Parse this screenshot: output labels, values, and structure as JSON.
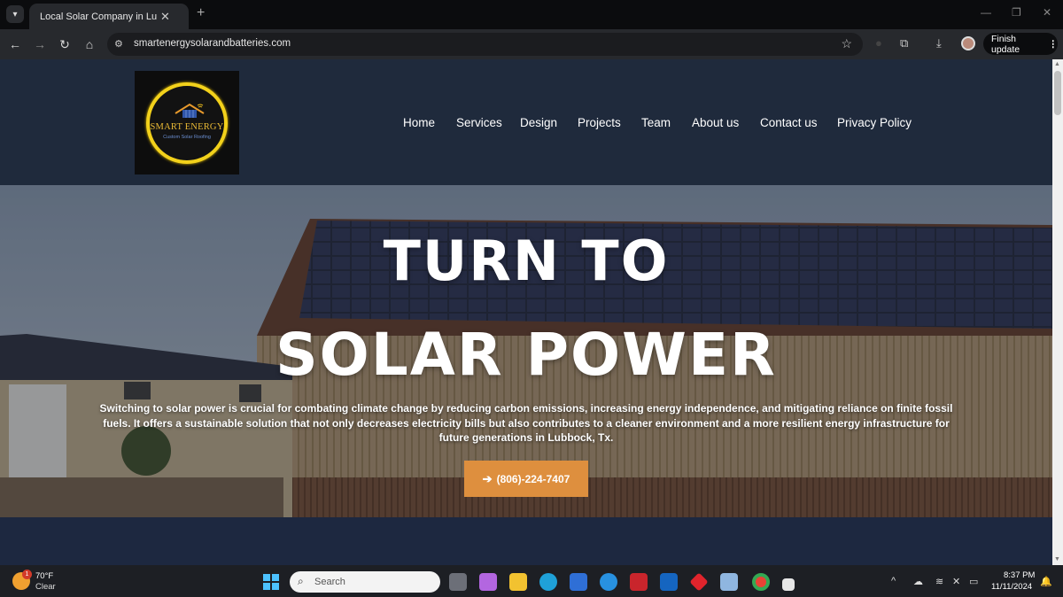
{
  "browser": {
    "tab_title": "Local Solar Company in Lubbock",
    "tab_close": "✕",
    "new_tab": "+",
    "url": "smartenergysolarandbatteries.com",
    "finish_update": "Finish update",
    "menu_dots": "⋮"
  },
  "site": {
    "logo": {
      "name": "SMART ENERGY",
      "tagline": "Custom Solar Roofing"
    },
    "nav": [
      "Home",
      "Services",
      "Design",
      "Projects",
      "Team",
      "About us",
      "Contact us",
      "Privacy Policy"
    ],
    "hero": {
      "headline_line1": "TURN TO",
      "headline_line2": "SOLAR POWER",
      "description": "Switching to solar power is crucial for combating climate change by reducing carbon emissions, increasing energy independence, and mitigating reliance on finite fossil fuels. It offers a sustainable solution that not only decreases electricity bills but also contributes to a cleaner environment and a more resilient energy infrastructure for future generations in Lubbock, Tx.",
      "cta_label": "(806)-224-7407",
      "cta_color": "#de8f3e"
    },
    "header_bg": "#1f2a3c"
  },
  "taskbar": {
    "weather_temp": "70°F",
    "weather_cond": "Clear",
    "weather_badge": "1",
    "search_placeholder": "Search",
    "time": "8:37 PM",
    "date": "11/11/2024"
  }
}
